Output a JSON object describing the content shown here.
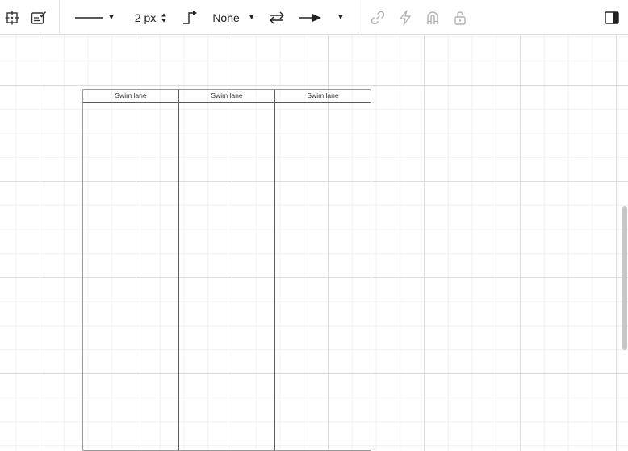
{
  "toolbar": {
    "stroke_width": "2 px",
    "line_start": "None",
    "icons": [
      "crosshair-icon",
      "checklist-icon",
      "line-style-icon",
      "caret-down-icon",
      "stepper-icon",
      "connector-elbow-icon",
      "swap-icon",
      "arrow-end-icon",
      "link-icon",
      "lightning-icon",
      "magnet-icon",
      "unlock-icon",
      "panel-toggle-icon"
    ]
  },
  "diagram": {
    "lanes": [
      {
        "label": "Swim lane"
      },
      {
        "label": "Swim lane"
      },
      {
        "label": "Swim lane"
      }
    ]
  },
  "colors": {
    "grid_major": "#dedede",
    "grid_minor": "#f0f0f0",
    "lane_border": "#5a5a5a",
    "disabled_icon": "#b0b0b0"
  }
}
